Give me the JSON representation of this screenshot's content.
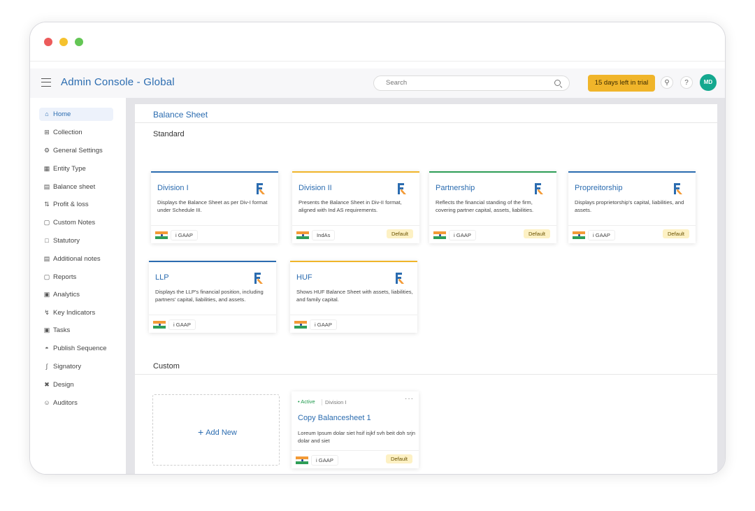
{
  "header": {
    "title": "Admin Console - Global",
    "search_placeholder": "Search",
    "trial_text": "15 days left in trial",
    "avatar_initials": "MD"
  },
  "sidebar": {
    "items": [
      {
        "label": "Home",
        "icon": "home-icon"
      },
      {
        "label": "Collection",
        "icon": "grid-icon"
      },
      {
        "label": "General Settings",
        "icon": "gear-icon"
      },
      {
        "label": "Entity Type",
        "icon": "building-icon"
      },
      {
        "label": "Balance sheet",
        "icon": "sheet-icon"
      },
      {
        "label": "Profit & loss",
        "icon": "arrows-icon"
      },
      {
        "label": "Custom Notes",
        "icon": "note-icon"
      },
      {
        "label": "Statutory",
        "icon": "document-icon"
      },
      {
        "label": "Additional notes",
        "icon": "notes-icon"
      },
      {
        "label": "Reports",
        "icon": "report-icon"
      },
      {
        "label": "Analytics",
        "icon": "chart-icon"
      },
      {
        "label": "Key Indicators",
        "icon": "indicator-icon"
      },
      {
        "label": "Tasks",
        "icon": "tasks-icon"
      },
      {
        "label": "Publish Sequence",
        "icon": "publish-icon"
      },
      {
        "label": "Signatory",
        "icon": "signature-icon"
      },
      {
        "label": "Design",
        "icon": "design-icon"
      },
      {
        "label": "Auditors",
        "icon": "user-icon"
      }
    ]
  },
  "main": {
    "title": "Balance Sheet",
    "standard_label": "Standard",
    "custom_label": "Custom",
    "standard_cards": [
      {
        "title": "Division I",
        "desc": "Displays the Balance Sheet as per Div-I format under Schedule III.",
        "gaap": "i GAAP",
        "badge": "",
        "accent": "#2b6cb0"
      },
      {
        "title": "Division II",
        "desc": "Presents the Balance Sheet in Div-II format, aligned with Ind AS requirements.",
        "gaap": "IndAs",
        "badge": "Default",
        "accent": "#f0b52a"
      },
      {
        "title": "Partnership",
        "desc": "Reflects the financial standing of the firm, covering partner capital, assets, liabilities.",
        "gaap": "i GAAP",
        "badge": "Default",
        "accent": "#2e9e57"
      },
      {
        "title": "Propreitorship",
        "desc": "Displays proprietorship's capital, liabilities, and assets.",
        "gaap": "i GAAP",
        "badge": "Default",
        "accent": "#2b6cb0"
      },
      {
        "title": "LLP",
        "desc": "Displays the LLP's financial position, including partners' capital, liabilities, and assets.",
        "gaap": "i GAAP",
        "badge": "",
        "accent": "#2b6cb0"
      },
      {
        "title": "HUF",
        "desc": "Shows HUF Balance Sheet with assets, liabilities, and family capital.",
        "gaap": "i GAAP",
        "badge": "",
        "accent": "#f0b52a"
      }
    ],
    "add_new_label": "Add New",
    "custom_card": {
      "status": "• Active",
      "division": "Division I",
      "title": "Copy Balancesheet 1",
      "desc": "Loreum Ipsum dolar siet hsif isjkf svh beit doh srjn dolar and siet",
      "gaap": "i GAAP",
      "badge": "Default"
    }
  }
}
